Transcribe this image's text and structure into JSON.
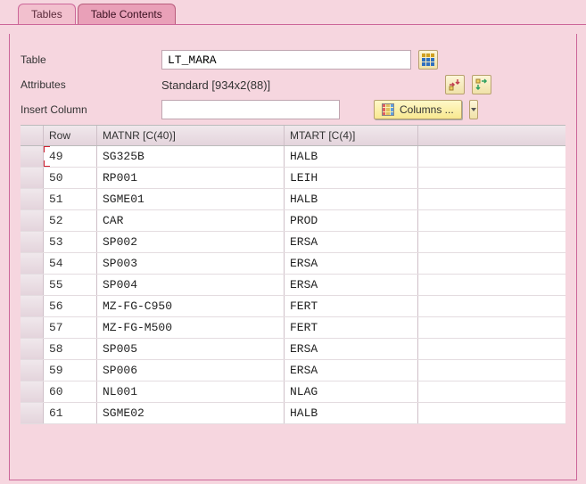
{
  "tabs": {
    "tables": "Tables",
    "contents": "Table Contents"
  },
  "labels": {
    "table": "Table",
    "attributes": "Attributes",
    "insertColumn": "Insert Column",
    "columnsBtn": "Columns ..."
  },
  "values": {
    "tableName": "LT_MARA",
    "attributes": "Standard [934x2(88)]",
    "insertColumn": ""
  },
  "grid": {
    "headers": {
      "rowhandle": "",
      "row": " Row",
      "c1": "MATNR [C(40)]",
      "c2": "MTART [C(4)]"
    },
    "rows": [
      {
        "n": "49",
        "c1": "SG325B",
        "c2": "HALB"
      },
      {
        "n": "50",
        "c1": "RP001",
        "c2": "LEIH"
      },
      {
        "n": "51",
        "c1": "SGME01",
        "c2": "HALB"
      },
      {
        "n": "52",
        "c1": "CAR",
        "c2": "PROD"
      },
      {
        "n": "53",
        "c1": "SP002",
        "c2": "ERSA"
      },
      {
        "n": "54",
        "c1": "SP003",
        "c2": "ERSA"
      },
      {
        "n": "55",
        "c1": "SP004",
        "c2": "ERSA"
      },
      {
        "n": "56",
        "c1": "MZ-FG-C950",
        "c2": "FERT"
      },
      {
        "n": "57",
        "c1": "MZ-FG-M500",
        "c2": "FERT"
      },
      {
        "n": "58",
        "c1": "SP005",
        "c2": "ERSA"
      },
      {
        "n": "59",
        "c1": "SP006",
        "c2": "ERSA"
      },
      {
        "n": "60",
        "c1": "NL001",
        "c2": "NLAG"
      },
      {
        "n": "61",
        "c1": "SGME02",
        "c2": "HALB"
      }
    ]
  }
}
